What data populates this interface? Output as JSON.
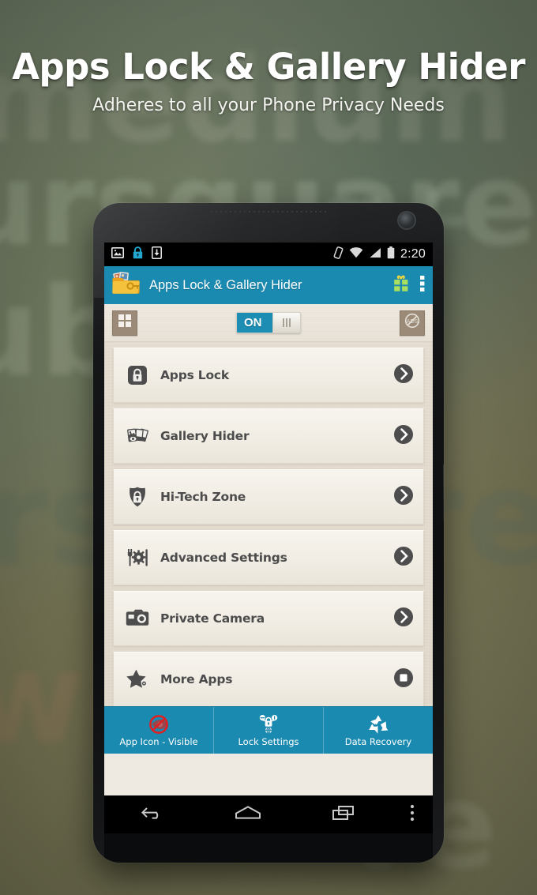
{
  "hero": {
    "title": "Apps Lock & Gallery Hider",
    "subtitle": "Adheres to all your Phone Privacy Needs"
  },
  "colors": {
    "accent": "#1b8ab0",
    "toolbar_button": "#9a8a77",
    "list_text": "#4c4c4c",
    "gift_green": "#9bd84a",
    "background": "#75806a"
  },
  "statusbar": {
    "time": "2:20",
    "left_icons": [
      "image-icon",
      "lock-icon",
      "download-icon"
    ],
    "right_icons": [
      "vibrate-icon",
      "wifi-icon",
      "signal-icon",
      "battery-icon"
    ]
  },
  "appbar": {
    "title": "Apps Lock & Gallery Hider",
    "app_icon": "folder-photos-key-icon",
    "gift_icon": "gift-icon",
    "overflow_icon": "overflow-menu-icon"
  },
  "toolbar": {
    "grid_icon": "grid-view-icon",
    "toggle_label": "ON",
    "toggle_state": "on",
    "no_ads_icon": "no-ads-icon"
  },
  "list": {
    "rows": [
      {
        "label": "Apps Lock",
        "icon": "lock-square-icon",
        "action": "chevron-right-circle-icon"
      },
      {
        "label": "Gallery Hider",
        "icon": "photo-cards-icon",
        "action": "chevron-right-circle-icon"
      },
      {
        "label": "Hi-Tech Zone",
        "icon": "shield-lock-icon",
        "action": "chevron-right-circle-icon"
      },
      {
        "label": "Advanced Settings",
        "icon": "tools-gear-icon",
        "action": "chevron-right-circle-icon"
      },
      {
        "label": "Private Camera",
        "icon": "camera-icon",
        "action": "chevron-right-circle-icon"
      },
      {
        "label": "More Apps",
        "icon": "star-icon",
        "action": "square-circle-icon"
      }
    ]
  },
  "tabs": [
    {
      "label": "App Icon - Visible",
      "icon": "eye-slash-icon"
    },
    {
      "label": "Lock Settings",
      "icon": "lock-settings-icon"
    },
    {
      "label": "Data Recovery",
      "icon": "recycle-icon"
    }
  ],
  "navbar": {
    "back": "back-icon",
    "home": "home-icon",
    "recents": "recents-icon",
    "menu": "menu-dots-icon"
  }
}
